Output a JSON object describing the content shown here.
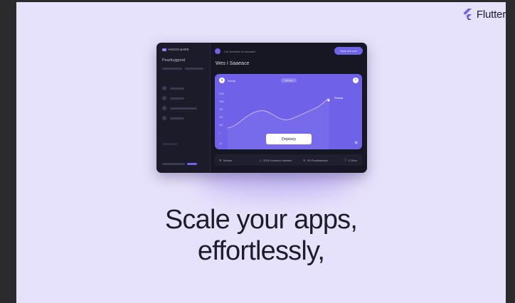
{
  "brand": {
    "name": "Flutter",
    "colors": {
      "accent": "#6f62e8",
      "background": "#e7e2fb",
      "text": "#1d1d29"
    }
  },
  "mockup": {
    "sidebar": {
      "logo_text": "•ASCOI &ARE",
      "title": "Pearfuyjgnsd"
    },
    "topbar": {
      "search_text": "Car wembafi on teecateir",
      "button": "Sass ore unir"
    },
    "title": "Wes I Saaeace",
    "chart_card": {
      "label": "Inrkdy",
      "pill": "ptteuses",
      "annotation": "Pbatcas",
      "y_ticks": [
        "5000",
        "2000",
        "200",
        "200",
        "500",
        "1",
        "0"
      ],
      "footer_left": "11",
      "deploy_label": "Depioey",
      "footer_right": "⊕"
    },
    "bottom_bar": {
      "items": [
        {
          "icon": "list-icon",
          "label": "Saaner"
        },
        {
          "icon": "user-icon",
          "label": "2000 Inreasve lastetes"
        },
        {
          "icon": "chart-icon",
          "label": "3G Paxtdiatvees"
        },
        {
          "icon": "info-icon",
          "label": "0 Dtea"
        }
      ]
    }
  },
  "headline": {
    "line1": "Scale your apps,",
    "line2": "effortlessly,"
  }
}
